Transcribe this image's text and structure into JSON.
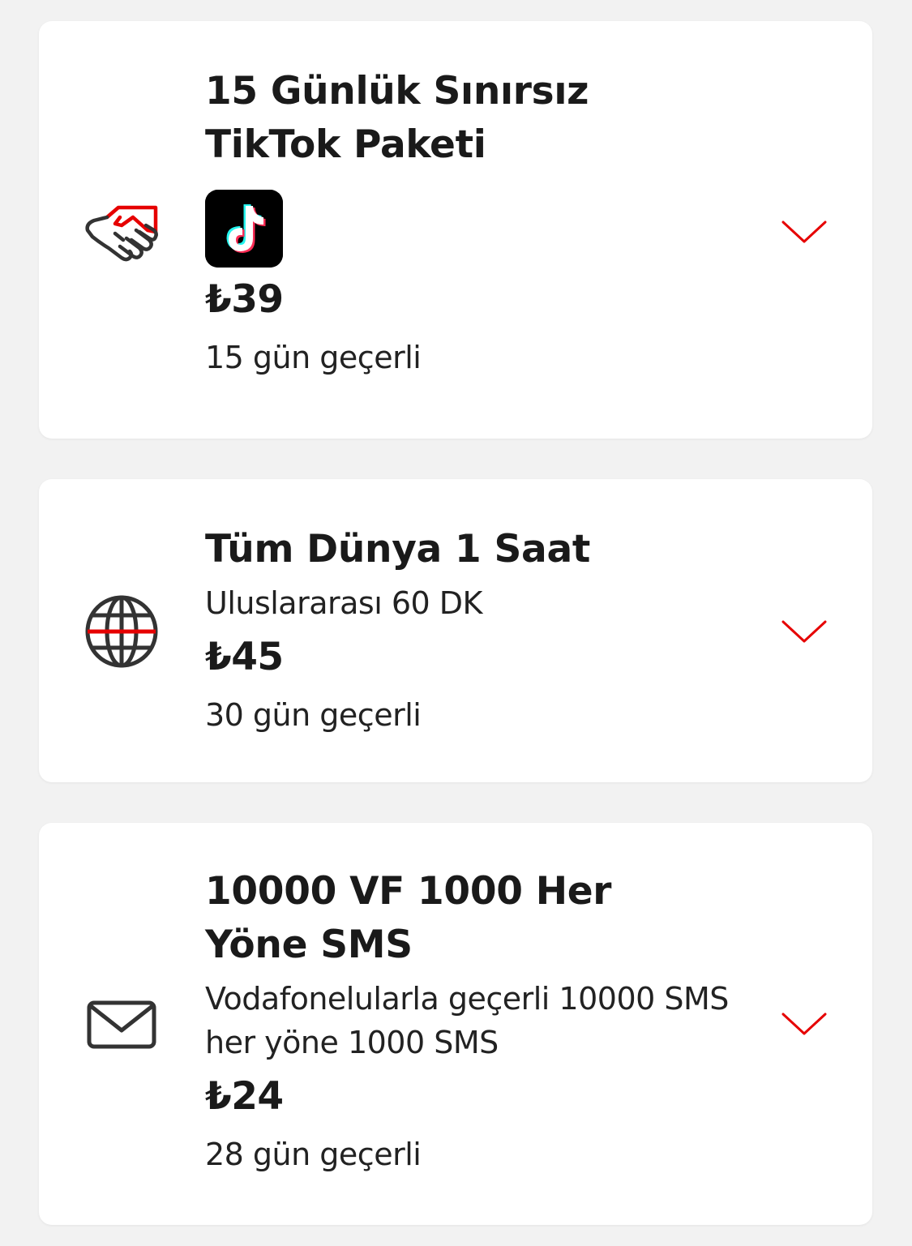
{
  "colors": {
    "accent": "#e60000",
    "background": "#f2f2f2",
    "card": "#ffffff",
    "text": "#1a1a1a",
    "icon_stroke": "#333333"
  },
  "packages": [
    {
      "icon": "handshake-icon",
      "title_lines": [
        "15 Günlük Sınırsız",
        "TikTok Paketi"
      ],
      "app_logo": "tiktok-logo-icon",
      "price": "₺39",
      "validity": "15 gün geçerli"
    },
    {
      "icon": "globe-icon",
      "title_lines": [
        "Tüm Dünya 1 Saat"
      ],
      "description_lines": [
        "Uluslararası 60 DK"
      ],
      "price": "₺45",
      "validity": "30 gün geçerli"
    },
    {
      "icon": "envelope-icon",
      "title_lines": [
        "10000 VF 1000 Her",
        "Yöne SMS"
      ],
      "description_lines": [
        "Vodafonelularla geçerli 10000 SMS",
        "her yöne 1000 SMS"
      ],
      "price": "₺24",
      "validity": "28 gün geçerli"
    }
  ]
}
